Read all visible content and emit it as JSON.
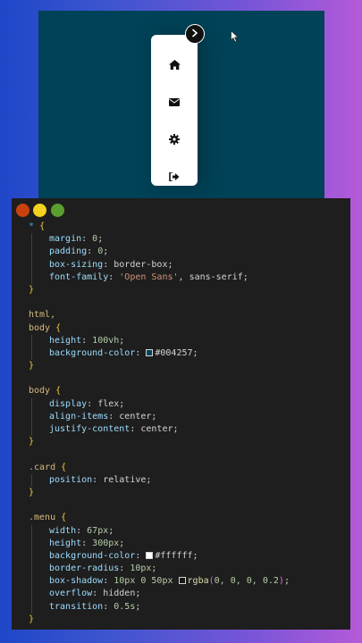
{
  "preview": {
    "background": "#004257",
    "menu_background": "#ffffff",
    "toggle_icon": "chevron-right-icon",
    "menu_items": [
      {
        "icon": "home-icon"
      },
      {
        "icon": "envelope-icon"
      },
      {
        "icon": "gear-icon"
      },
      {
        "icon": "sign-out-icon"
      }
    ]
  },
  "editor": {
    "window_dots": [
      "#c9420d",
      "#f2d21c",
      "#5a9e2f"
    ],
    "lines": {
      "l1_sel": "*",
      "l1_brace": "{",
      "l2_prop": "margin",
      "l2_val": "0",
      "l3_prop": "padding",
      "l3_val": "0",
      "l4_prop": "box-sizing",
      "l4_val": "border-box",
      "l5_prop": "font-family",
      "l5_str": "'Open Sans'",
      "l5_val": "sans-serif",
      "l6_brace": "}",
      "l8_sel": "html,",
      "l9_sel": "body",
      "l9_brace": "{",
      "l10_prop": "height",
      "l10_val": "100vh",
      "l11_prop": "background-color",
      "l11_val": "#004257",
      "l12_brace": "}",
      "l14_sel": "body",
      "l14_brace": "{",
      "l15_prop": "display",
      "l15_val": "flex",
      "l16_prop": "align-items",
      "l16_val": "center",
      "l17_prop": "justify-content",
      "l17_val": "center",
      "l18_brace": "}",
      "l20_sel": ".card",
      "l20_brace": "{",
      "l21_prop": "position",
      "l21_val": "relative",
      "l22_brace": "}",
      "l24_sel": ".menu",
      "l24_brace": "{",
      "l25_prop": "width",
      "l25_val": "67px",
      "l26_prop": "height",
      "l26_val": "300px",
      "l27_prop": "background-color",
      "l27_val": "#ffffff",
      "l28_prop": "border-radius",
      "l28_val": "10px",
      "l29_prop": "box-shadow",
      "l29_val": "10px 0 50px",
      "l29_fn": "rgba",
      "l29_args": "0, 0, 0, 0.2",
      "l30_prop": "overflow",
      "l30_val": "hidden",
      "l31_prop": "transition",
      "l31_val": "0.5s",
      "l32_brace": "}"
    }
  }
}
